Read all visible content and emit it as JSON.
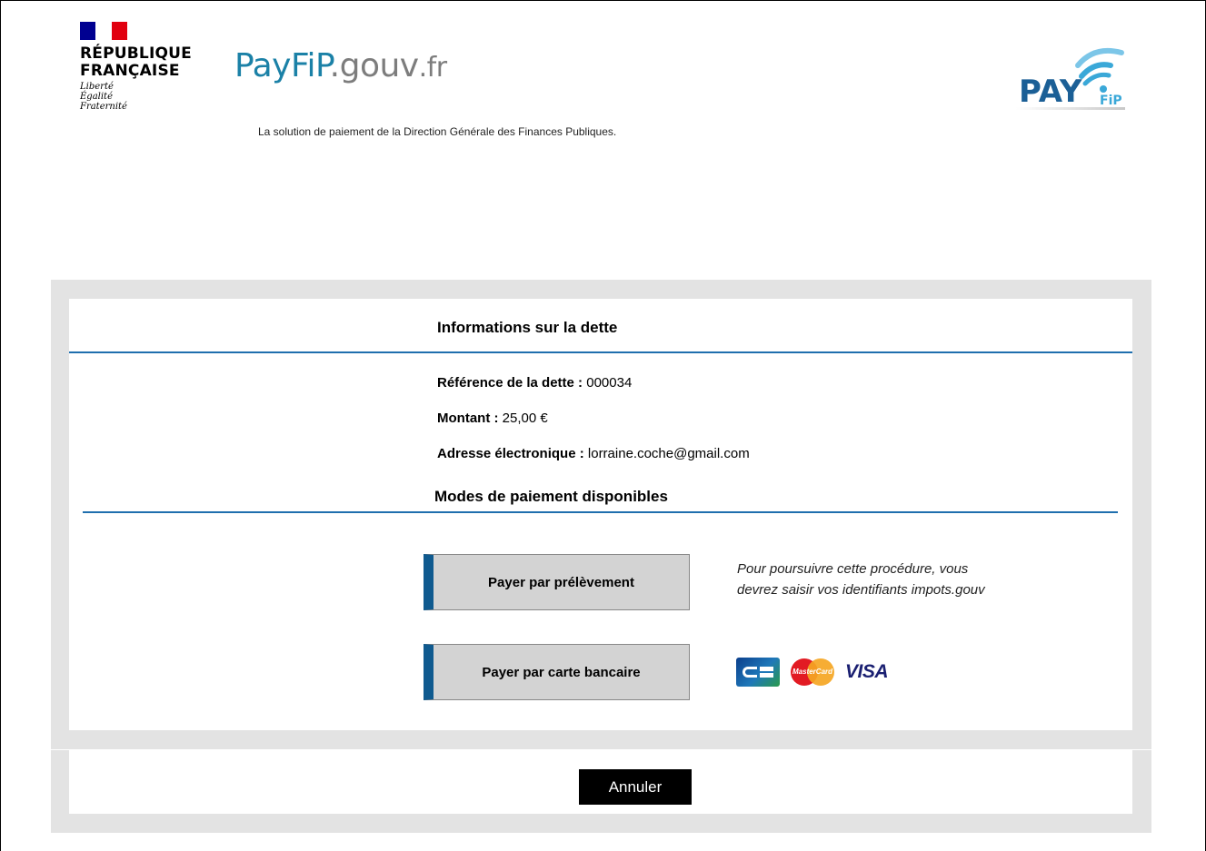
{
  "header": {
    "republique_line1": "RÉPUBLIQUE",
    "republique_line2": "FRANÇAISE",
    "devise_1": "Liberté",
    "devise_2": "Égalité",
    "devise_3": "Fraternité",
    "site_name_part1": "PayFiP",
    "site_name_part2": ".gouv",
    "site_name_part3": ".fr",
    "tagline": "La solution de paiement de la Direction Générale des Finances Publiques.",
    "logo_text": "PAY",
    "logo_sub": "FiP"
  },
  "debt": {
    "section_title": "Informations sur la dette",
    "reference_label": "Référence de la dette :",
    "reference_value": "000034",
    "amount_label": "Montant :",
    "amount_value": "25,00 €",
    "email_label": "Adresse électronique :",
    "email_value": "lorraine.coche@gmail.com"
  },
  "payment": {
    "section_title": "Modes de paiement disponibles",
    "direct_debit_button": "Payer par prélèvement",
    "direct_debit_note": "Pour poursuivre cette procédure, vous devrez saisir vos identifiants impots.gouv",
    "card_button": "Payer par carte bancaire",
    "card_brands": [
      "CB",
      "MasterCard",
      "VISA"
    ]
  },
  "actions": {
    "cancel_button": "Annuler"
  },
  "colors": {
    "accent_blue": "#1f6fae",
    "button_bar": "#0f5a8f",
    "panel_grey": "#e3e3e3"
  }
}
